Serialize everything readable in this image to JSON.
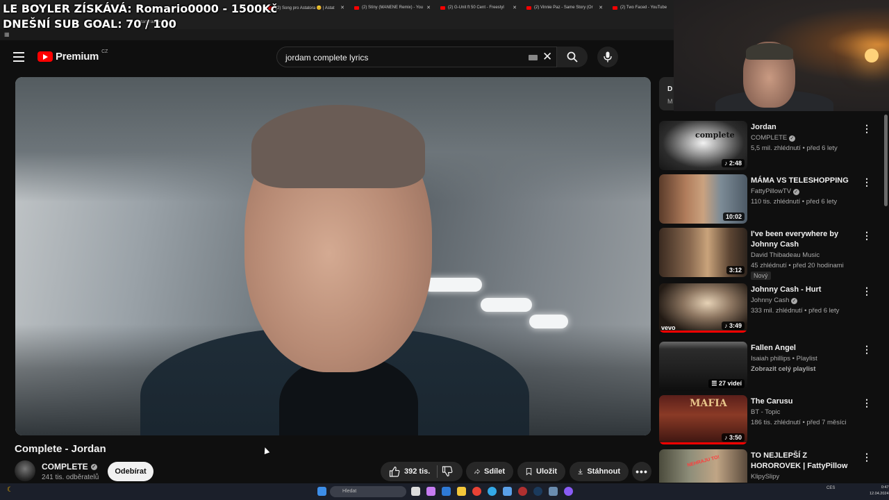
{
  "overlay": {
    "line1": "LE BOYLER ZÍSKÁVÁ: Romario0000 - 1500Kč",
    "line2": "DNEŠNÍ SUB GOAL: 70 / 100"
  },
  "browser": {
    "tabs": [
      {
        "label": "(2) Song pro Astatora 😊 | Astat"
      },
      {
        "label": "(2) Stíny (MANENE Remix) - You"
      },
      {
        "label": "(2) G-Unit ft 50 Cent - Freestyl"
      },
      {
        "label": "(2) Vinnie Paz - Same Story (Or"
      },
      {
        "label": "(2) Two Faced - YouTube"
      }
    ],
    "url_fragment": "start_radio=1"
  },
  "header": {
    "brand": "Premium",
    "region": "CZ",
    "search_query": "jordam complete lyrics"
  },
  "video": {
    "title": "Complete - Jordan",
    "channel": "COMPLETE",
    "subscribers": "241 tis. odběratelů",
    "subscribe_label": "Odebírat",
    "likes": "392 tis.",
    "share_label": "Sdílet",
    "save_label": "Uložit",
    "download_label": "Stáhnout"
  },
  "sidebar": {
    "partial": {
      "title": "D",
      "sub": "M"
    },
    "items": [
      {
        "title": "Jordan",
        "channel": "COMPLETE",
        "verified": true,
        "meta": "5,5 mil. zhlédnutí • před 6 lety",
        "duration": "2:48",
        "short_icon": true
      },
      {
        "title": "MÁMA VS TELESHOPPING",
        "channel": "FattyPillowTV",
        "verified": true,
        "meta": "110 tis. zhlédnutí • před 6 lety",
        "duration": "10:02"
      },
      {
        "title": "I've been everywhere by Johnny Cash",
        "channel": "David Thibadeau Music",
        "meta": "45 zhlédnutí • před 20 hodinami",
        "badge": "Nový",
        "duration": "3:12"
      },
      {
        "title": "Johnny Cash - Hurt",
        "channel": "Johnny Cash",
        "verified": true,
        "meta": "333 mil. zhlédnutí • před 6 lety",
        "duration": "3:49",
        "short_icon": true,
        "thumb_label": "vevo"
      },
      {
        "title": "Fallen Angel",
        "channel": "Isaiah phillips • Playlist",
        "meta": "Zobrazit celý playlist",
        "duration": "27 videí"
      },
      {
        "title": "The Carusu",
        "channel": "BT - Topic",
        "meta": "186 tis. zhlédnutí • před 7 měsíci",
        "duration": "3:50",
        "short_icon": true,
        "thumb_label": "MAFIA"
      },
      {
        "title": "TO NEJLEPŠÍ Z HOROROVEK | FattyPillow",
        "channel": "KlipySlipy",
        "meta": "",
        "thumb_label": "NEHRAJU TO!"
      }
    ]
  },
  "taskbar": {
    "search_placeholder": "Hledat",
    "tray_lang": "CES",
    "time": "0:47",
    "date": "12.04.2024"
  },
  "colors": {
    "accent": "#ff0000",
    "background": "#0f0f0f",
    "surface": "#272727",
    "text_secondary": "#aaaaaa"
  }
}
